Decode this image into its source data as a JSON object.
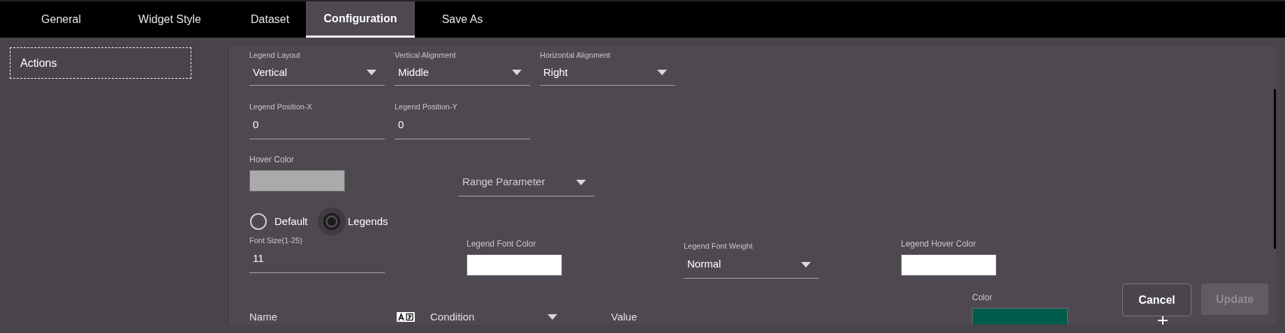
{
  "tabs": [
    {
      "label": "General",
      "selected": false
    },
    {
      "label": "Widget Style",
      "selected": false
    },
    {
      "label": "Dataset",
      "selected": false
    },
    {
      "label": "Configuration",
      "selected": true
    },
    {
      "label": "Save As",
      "selected": false
    }
  ],
  "sidebar": {
    "items": [
      {
        "label": "Actions",
        "focused": true
      }
    ]
  },
  "form_rows": [
    {
      "fields": [
        {
          "kind": "select",
          "label": "Legend Layout",
          "value": "Vertical"
        },
        {
          "kind": "select",
          "label": "Vertical Alignment",
          "value": "Middle"
        },
        {
          "kind": "select",
          "label": "Horizontal Alignment",
          "value": "Right"
        }
      ]
    },
    {
      "fields": [
        {
          "kind": "input",
          "label": "Legend Position-X",
          "value": "0"
        },
        {
          "kind": "input",
          "label": "Legend Position-Y",
          "value": "0"
        }
      ]
    },
    {
      "fields": [
        {
          "kind": "color",
          "label": "Hover Color",
          "color": "#aaaaaa"
        },
        {
          "kind": "select",
          "placeholder": "Range Parameter"
        }
      ]
    },
    {
      "fields": [
        {
          "kind": "radio_group",
          "options": [
            {
              "label": "Default",
              "selected": false
            },
            {
              "label": "Legends",
              "selected": true
            }
          ]
        }
      ]
    },
    {
      "fields": [
        {
          "kind": "input",
          "label": "Font Size(1-25)",
          "value": "11"
        },
        {
          "kind": "color",
          "label": "Legend Font Color",
          "color": "#ffffff"
        },
        {
          "kind": "select",
          "label": "Legend Font Weight",
          "value": "Normal"
        },
        {
          "kind": "color",
          "label": "Legend Hover Color",
          "color": "#ffffff"
        }
      ]
    },
    {
      "fields": [
        {
          "kind": "lang_header",
          "text": "Name"
        },
        {
          "kind": "select_header",
          "text": "Condition"
        },
        {
          "kind": "header",
          "text": "Value"
        },
        {
          "kind": "color",
          "label": "Color",
          "color": "#005c4a"
        },
        {
          "kind": "add_button"
        }
      ]
    }
  ],
  "buttons": [
    {
      "label": "Cancel",
      "disabled": false
    },
    {
      "label": "Update",
      "disabled": true
    }
  ]
}
